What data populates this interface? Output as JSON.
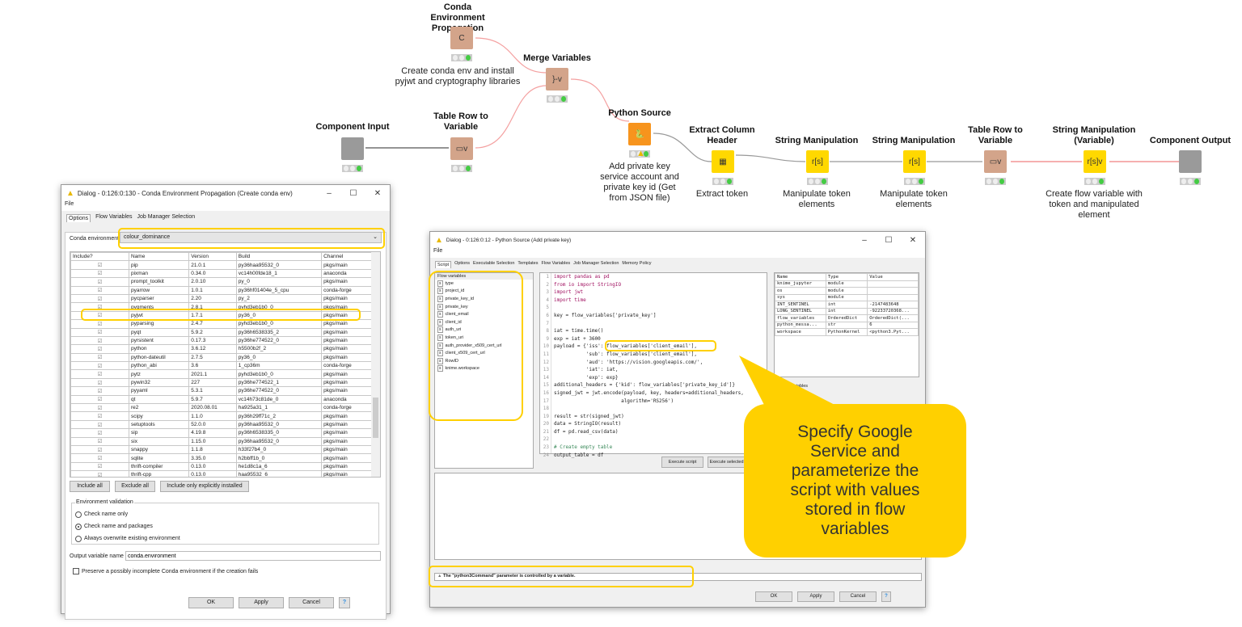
{
  "workflow": {
    "nodes": [
      {
        "title": "Conda Environment Propagation",
        "desc": "Create conda env and install pyjwt and cryptography libraries",
        "icon": "C"
      },
      {
        "title": "Merge Variables",
        "desc": "",
        "icon": "}-v"
      },
      {
        "title": "Component Input",
        "desc": "",
        "icon": ""
      },
      {
        "title": "Table Row to Variable",
        "desc": "",
        "icon": "▭v"
      },
      {
        "title": "Python Source",
        "desc": "Add private key service account and private key id (Get from JSON file)",
        "icon": "🐍"
      },
      {
        "title": "Extract Column Header",
        "desc": "Extract token",
        "icon": "▦"
      },
      {
        "title": "String Manipulation",
        "desc": "Manipulate token elements",
        "icon": "r[s]"
      },
      {
        "title": "String Manipulation",
        "desc": "Manipulate token elements",
        "icon": "r[s]"
      },
      {
        "title": "Table Row to Variable",
        "desc": "",
        "icon": "▭v"
      },
      {
        "title": "String Manipulation (Variable)",
        "desc": "Create flow variable with token and manipulated element",
        "icon": "r[s]v"
      },
      {
        "title": "Component Output",
        "desc": "",
        "icon": ""
      }
    ],
    "colors": {
      "manipulator": "#ffd800",
      "flow": "#d3a48a",
      "source": "#f7941d",
      "component": "#9a9a9a",
      "var_connection": "#f08080"
    }
  },
  "conda_dialog": {
    "title": "Dialog - 0:126:0:130 - Conda Environment Propagation (Create conda env)",
    "menu": "File",
    "tabs": [
      "Options",
      "Flow Variables",
      "Job Manager Selection"
    ],
    "env_label": "Conda environment",
    "env_value": "colour_dominance",
    "columns": [
      "Include?",
      "Name",
      "Version",
      "Build",
      "Channel"
    ],
    "packages": [
      [
        "pip",
        "21.0.1",
        "py36haa95532_0",
        "pkgs/main"
      ],
      [
        "pixman",
        "0.34.0",
        "vc14h00fde18_1",
        "anaconda"
      ],
      [
        "prompt_toolkit",
        "2.0.10",
        "py_0",
        "pkgs/main"
      ],
      [
        "pyarrow",
        "1.0.1",
        "py36hf01404e_5_cpu",
        "conda-forge"
      ],
      [
        "pycparser",
        "2.20",
        "py_2",
        "pkgs/main"
      ],
      [
        "pygments",
        "2.8.1",
        "pyhd3eb1b0_0",
        "pkgs/main"
      ],
      [
        "pyjwt",
        "1.7.1",
        "py36_0",
        "pkgs/main"
      ],
      [
        "pyparsing",
        "2.4.7",
        "pyhd3eb1b0_0",
        "pkgs/main"
      ],
      [
        "pyqt",
        "5.9.2",
        "py36h6538335_2",
        "pkgs/main"
      ],
      [
        "pyrsistent",
        "0.17.3",
        "py36he774522_0",
        "pkgs/main"
      ],
      [
        "python",
        "3.6.12",
        "h5500b2f_2",
        "pkgs/main"
      ],
      [
        "python-dateutil",
        "2.7.5",
        "py36_0",
        "pkgs/main"
      ],
      [
        "python_abi",
        "3.6",
        "1_cp36m",
        "conda-forge"
      ],
      [
        "pytz",
        "2021.1",
        "pyhd3eb1b0_0",
        "pkgs/main"
      ],
      [
        "pywin32",
        "227",
        "py36he774522_1",
        "pkgs/main"
      ],
      [
        "pyyaml",
        "5.3.1",
        "py36he774522_0",
        "pkgs/main"
      ],
      [
        "qt",
        "5.9.7",
        "vc14h73c81de_0",
        "anaconda"
      ],
      [
        "re2",
        "2020.08.01",
        "ha925a31_1",
        "conda-forge"
      ],
      [
        "scipy",
        "1.1.0",
        "py36h29ff71c_2",
        "pkgs/main"
      ],
      [
        "setuptools",
        "52.0.0",
        "py36haa95532_0",
        "pkgs/main"
      ],
      [
        "sip",
        "4.19.8",
        "py36h6538335_0",
        "pkgs/main"
      ],
      [
        "six",
        "1.15.0",
        "py36haa95532_0",
        "pkgs/main"
      ],
      [
        "snappy",
        "1.1.8",
        "h33f27b4_0",
        "pkgs/main"
      ],
      [
        "sqlite",
        "3.35.0",
        "h2bbff1b_0",
        "pkgs/main"
      ],
      [
        "thrift-compiler",
        "0.13.0",
        "he1d8c1a_6",
        "pkgs/main"
      ],
      [
        "thrift-cpp",
        "0.13.0",
        "haa95532_6",
        "pkgs/main"
      ]
    ],
    "buttons": {
      "include_all": "Include all",
      "exclude_all": "Exclude all",
      "include_explicit": "Include only explicitly installed"
    },
    "validation": {
      "legend": "Environment validation",
      "options": [
        "Check name only",
        "Check name and packages",
        "Always overwrite existing environment"
      ],
      "selected": 1
    },
    "output_label": "Output variable name",
    "output_value": "conda.environment",
    "preserve_label": "Preserve a possibly incomplete Conda environment if the creation fails",
    "footer": {
      "ok": "OK",
      "apply": "Apply",
      "cancel": "Cancel",
      "help": "?"
    }
  },
  "python_dialog": {
    "title": "Dialog - 0:126:0:12 - Python Source (Add private key)",
    "menu": "File",
    "tabs": [
      "Script",
      "Options",
      "Executable Selection",
      "Templates",
      "Flow Variables",
      "Job Manager Selection",
      "Memory Policy"
    ],
    "flow_vars_header": "Flow variables",
    "flow_vars": [
      "type",
      "project_id",
      "private_key_id",
      "private_key",
      "client_email",
      "client_id",
      "auth_uri",
      "token_uri",
      "auth_provider_x509_cert_url",
      "client_x509_cert_url",
      "RowID",
      "knime.workspace"
    ],
    "code": [
      "import pandas as pd",
      "from io import StringIO",
      "import jwt",
      "import time",
      "",
      "key = flow_variables['private_key']",
      "",
      "iat = time.time()",
      "exp = iat + 3600",
      "payload = {'iss': flow_variables['client_email'],",
      "           'sub': flow_variables['client_email'],",
      "           'aud': 'https://vision.googleapis.com/',",
      "           'iat': iat,",
      "           'exp': exp}",
      "additional_headers = {'kid': flow_variables['private_key_id']}",
      "signed_jwt = jwt.encode(payload, key, headers=additional_headers,",
      "                       algorithm='RS256')",
      "",
      "result = str(signed_jwt)",
      "data = StringIO(result)",
      "df = pd.read_csv(data)",
      "",
      "# Create empty table",
      "output_table = df"
    ],
    "code_line_numbers": [
      "1",
      "2",
      "3",
      "4",
      "5",
      "6",
      "7",
      "8",
      "9",
      "10",
      "11",
      "12",
      "13",
      "14",
      "15",
      "16",
      "17",
      "18",
      "19",
      "20",
      "21",
      "22",
      "23",
      "24"
    ],
    "execute_script": "Execute script",
    "execute_selected": "Execute selected lines",
    "workspace_columns": [
      "Name",
      "Type",
      "Value"
    ],
    "workspace_rows": [
      [
        "knime_jupyter",
        "module",
        ""
      ],
      [
        "os",
        "module",
        ""
      ],
      [
        "sys",
        "module",
        ""
      ],
      [
        "INT_SENTINEL",
        "int",
        "-2147483648"
      ],
      [
        "LONG_SENTINEL",
        "int",
        "-92233720368..."
      ],
      [
        "flow_variables",
        "OrderedDict",
        "OrderedDict(..."
      ],
      [
        "python_messa...",
        "str",
        "6"
      ],
      [
        "workspace",
        "PythonKernel",
        "<python3.Pyt..."
      ]
    ],
    "output_vars_header": "Output variables",
    "warning": "The \"python3Command\" parameter is controlled by a variable.",
    "footer": {
      "ok": "OK",
      "apply": "Apply",
      "cancel": "Cancel",
      "help": "?"
    }
  },
  "callout": {
    "text": "Specify Google Service and parameterize the script with values stored in flow variables",
    "color": "#ffd000"
  }
}
